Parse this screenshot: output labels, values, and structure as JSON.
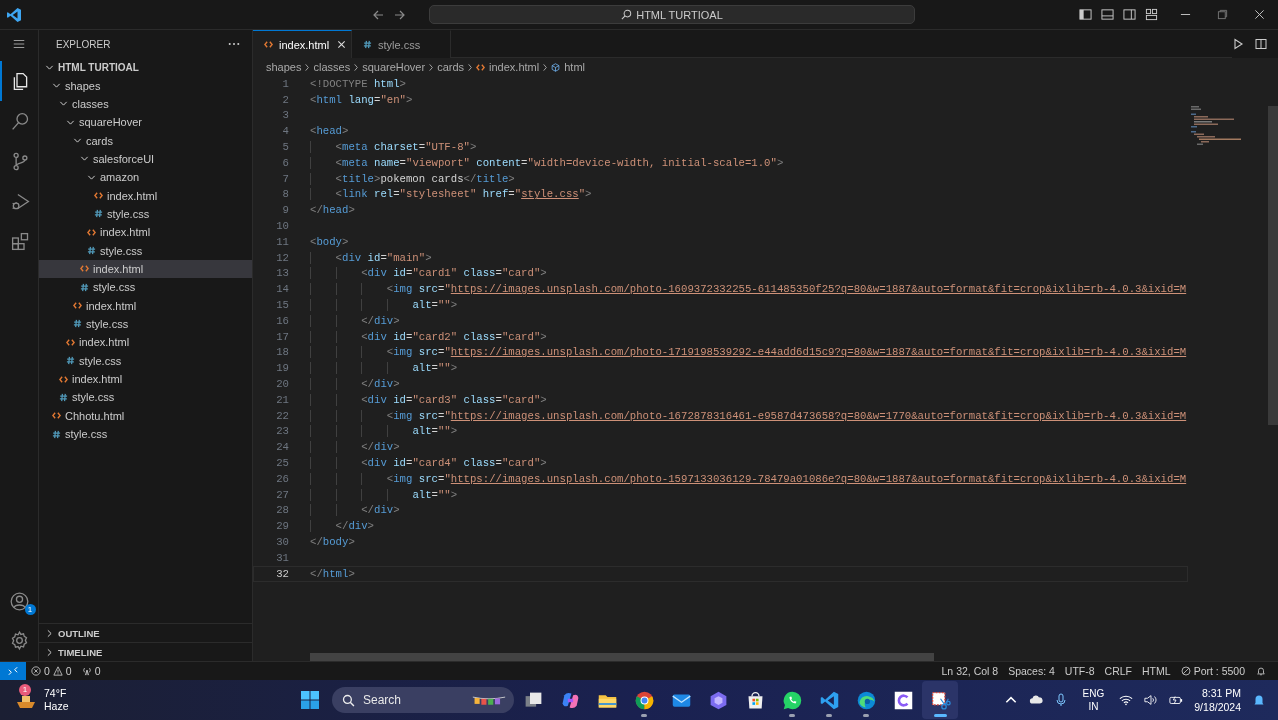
{
  "title_bar": {
    "search": "HTML TURTIOAL"
  },
  "activity_bar": {
    "items": [
      {
        "kind": "explorer",
        "selected": true
      },
      {
        "kind": "search",
        "selected": false
      },
      {
        "kind": "source-control",
        "selected": false
      },
      {
        "kind": "run",
        "selected": false
      },
      {
        "kind": "extensions",
        "selected": false
      }
    ],
    "account_badge": "1"
  },
  "sidebar": {
    "title": "EXPLORER",
    "tree": [
      {
        "label": "HTML TURTIOAL",
        "kind": "root",
        "expanded": true,
        "selected": false,
        "children": [
          {
            "label": "shapes",
            "kind": "folder",
            "expanded": true,
            "selected": false,
            "children": [
              {
                "label": "classes",
                "kind": "folder",
                "expanded": true,
                "selected": false,
                "children": [
                  {
                    "label": "squareHover",
                    "kind": "folder",
                    "expanded": true,
                    "selected": false,
                    "children": [
                      {
                        "label": "cards",
                        "kind": "folder",
                        "expanded": true,
                        "selected": false,
                        "children": [
                          {
                            "label": "salesforceUI",
                            "kind": "folder",
                            "expanded": true,
                            "selected": false,
                            "children": [
                              {
                                "label": "amazon",
                                "kind": "folder",
                                "expanded": true,
                                "selected": false,
                                "children": [
                                  {
                                    "label": "index.html",
                                    "kind": "html",
                                    "selected": false
                                  },
                                  {
                                    "label": "style.css",
                                    "kind": "css",
                                    "selected": false
                                  }
                                ]
                              },
                              {
                                "label": "index.html",
                                "kind": "html",
                                "selected": false
                              },
                              {
                                "label": "style.css",
                                "kind": "css",
                                "selected": false
                              }
                            ]
                          },
                          {
                            "label": "index.html",
                            "kind": "html",
                            "selected": true
                          },
                          {
                            "label": "style.css",
                            "kind": "css",
                            "selected": false
                          }
                        ]
                      },
                      {
                        "label": "index.html",
                        "kind": "html",
                        "selected": false
                      },
                      {
                        "label": "style.css",
                        "kind": "css",
                        "selected": false
                      }
                    ]
                  },
                  {
                    "label": "index.html",
                    "kind": "html",
                    "selected": false
                  },
                  {
                    "label": "style.css",
                    "kind": "css",
                    "selected": false
                  }
                ]
              },
              {
                "label": "index.html",
                "kind": "html",
                "selected": false
              },
              {
                "label": "style.css",
                "kind": "css",
                "selected": false
              }
            ]
          },
          {
            "label": "Chhotu.html",
            "kind": "html",
            "selected": false
          },
          {
            "label": "style.css",
            "kind": "css",
            "selected": false
          }
        ]
      }
    ],
    "sections": [
      {
        "label": "OUTLINE",
        "expanded": false
      },
      {
        "label": "TIMELINE",
        "expanded": false
      }
    ]
  },
  "tabs": [
    {
      "label": "index.html",
      "kind": "html",
      "selected": true
    },
    {
      "label": "style.css",
      "kind": "css",
      "selected": false
    }
  ],
  "breadcrumb": [
    {
      "label": "shapes",
      "kind": "folder"
    },
    {
      "label": "classes",
      "kind": "folder"
    },
    {
      "label": "squareHover",
      "kind": "folder"
    },
    {
      "label": "cards",
      "kind": "folder"
    },
    {
      "label": "index.html",
      "kind": "html"
    },
    {
      "label": "html",
      "kind": "symbol"
    }
  ],
  "editor": {
    "lines": [
      {
        "number": "1",
        "current": false,
        "tokens": [
          {
            "kind": "p",
            "text": "<!DOCTYPE"
          },
          {
            "kind": "a",
            "text": " html"
          },
          {
            "kind": "p",
            "text": ">"
          }
        ]
      },
      {
        "number": "2",
        "current": false,
        "tokens": [
          {
            "kind": "p",
            "text": "<"
          },
          {
            "kind": "t",
            "text": "html"
          },
          {
            "kind": "a",
            "text": " lang"
          },
          {
            "kind": "x",
            "text": "="
          },
          {
            "kind": "s",
            "text": "\"en\""
          },
          {
            "kind": "p",
            "text": ">"
          }
        ]
      },
      {
        "number": "3",
        "current": false
      },
      {
        "number": "4",
        "current": false,
        "tokens": [
          {
            "kind": "p",
            "text": "<"
          },
          {
            "kind": "t",
            "text": "head"
          },
          {
            "kind": "p",
            "text": ">"
          }
        ]
      },
      {
        "number": "5",
        "current": false,
        "tokens": [
          {
            "kind": "p",
            "text": "    <"
          },
          {
            "kind": "t",
            "text": "meta"
          },
          {
            "kind": "a",
            "text": " charset"
          },
          {
            "kind": "x",
            "text": "="
          },
          {
            "kind": "s",
            "text": "\"UTF-8\""
          },
          {
            "kind": "p",
            "text": ">"
          }
        ]
      },
      {
        "number": "6",
        "current": false,
        "tokens": [
          {
            "kind": "p",
            "text": "    <"
          },
          {
            "kind": "t",
            "text": "meta"
          },
          {
            "kind": "a",
            "text": " name"
          },
          {
            "kind": "x",
            "text": "="
          },
          {
            "kind": "s",
            "text": "\"viewport\""
          },
          {
            "kind": "a",
            "text": " content"
          },
          {
            "kind": "x",
            "text": "="
          },
          {
            "kind": "s",
            "text": "\"width=device-width, initial-scale=1.0\""
          },
          {
            "kind": "p",
            "text": ">"
          }
        ]
      },
      {
        "number": "7",
        "current": false,
        "tokens": [
          {
            "kind": "p",
            "text": "    <"
          },
          {
            "kind": "t",
            "text": "title"
          },
          {
            "kind": "p",
            "text": ">"
          },
          {
            "kind": "x",
            "text": "pokemon cards"
          },
          {
            "kind": "p",
            "text": "</"
          },
          {
            "kind": "t",
            "text": "title"
          },
          {
            "kind": "p",
            "text": ">"
          }
        ]
      },
      {
        "number": "8",
        "current": false,
        "tokens": [
          {
            "kind": "p",
            "text": "    <"
          },
          {
            "kind": "t",
            "text": "link"
          },
          {
            "kind": "a",
            "text": " rel"
          },
          {
            "kind": "x",
            "text": "="
          },
          {
            "kind": "s",
            "text": "\"stylesheet\""
          },
          {
            "kind": "a",
            "text": " href"
          },
          {
            "kind": "x",
            "text": "="
          },
          {
            "kind": "s",
            "text": "\""
          },
          {
            "kind": "u",
            "text": "style.css"
          },
          {
            "kind": "s",
            "text": "\""
          },
          {
            "kind": "p",
            "text": ">"
          }
        ]
      },
      {
        "number": "9",
        "current": false,
        "tokens": [
          {
            "kind": "p",
            "text": "</"
          },
          {
            "kind": "t",
            "text": "head"
          },
          {
            "kind": "p",
            "text": ">"
          }
        ]
      },
      {
        "number": "10",
        "current": false
      },
      {
        "number": "11",
        "current": false,
        "tokens": [
          {
            "kind": "p",
            "text": "<"
          },
          {
            "kind": "t",
            "text": "body"
          },
          {
            "kind": "p",
            "text": ">"
          }
        ]
      },
      {
        "number": "12",
        "current": false,
        "tokens": [
          {
            "kind": "p",
            "text": "    <"
          },
          {
            "kind": "t",
            "text": "div"
          },
          {
            "kind": "a",
            "text": " id"
          },
          {
            "kind": "x",
            "text": "="
          },
          {
            "kind": "s",
            "text": "\"main\""
          },
          {
            "kind": "p",
            "text": ">"
          }
        ]
      },
      {
        "number": "13",
        "current": false,
        "tokens": [
          {
            "kind": "p",
            "text": "        <"
          },
          {
            "kind": "t",
            "text": "div"
          },
          {
            "kind": "a",
            "text": " id"
          },
          {
            "kind": "x",
            "text": "="
          },
          {
            "kind": "s",
            "text": "\"card1\""
          },
          {
            "kind": "a",
            "text": " class"
          },
          {
            "kind": "x",
            "text": "="
          },
          {
            "kind": "s",
            "text": "\"card\""
          },
          {
            "kind": "p",
            "text": ">"
          }
        ]
      },
      {
        "number": "14",
        "current": false,
        "tokens": [
          {
            "kind": "p",
            "text": "            <"
          },
          {
            "kind": "t",
            "text": "img"
          },
          {
            "kind": "a",
            "text": " src"
          },
          {
            "kind": "x",
            "text": "="
          },
          {
            "kind": "s",
            "text": "\""
          },
          {
            "kind": "u",
            "text": "https://images.unsplash.com/photo-1609372332255-611485350f25?q=80&w=1887&auto=format&fit=crop&ixlib=rb-4.0.3&ixid=M"
          }
        ]
      },
      {
        "number": "15",
        "current": false,
        "tokens": [
          {
            "kind": "a",
            "text": "                alt"
          },
          {
            "kind": "x",
            "text": "="
          },
          {
            "kind": "s",
            "text": "\"\""
          },
          {
            "kind": "p",
            "text": ">"
          }
        ]
      },
      {
        "number": "16",
        "current": false,
        "tokens": [
          {
            "kind": "p",
            "text": "        </"
          },
          {
            "kind": "t",
            "text": "div"
          },
          {
            "kind": "p",
            "text": ">"
          }
        ]
      },
      {
        "number": "17",
        "current": false,
        "tokens": [
          {
            "kind": "p",
            "text": "        <"
          },
          {
            "kind": "t",
            "text": "div"
          },
          {
            "kind": "a",
            "text": " id"
          },
          {
            "kind": "x",
            "text": "="
          },
          {
            "kind": "s",
            "text": "\"card2\""
          },
          {
            "kind": "a",
            "text": " class"
          },
          {
            "kind": "x",
            "text": "="
          },
          {
            "kind": "s",
            "text": "\"card\""
          },
          {
            "kind": "p",
            "text": ">"
          }
        ]
      },
      {
        "number": "18",
        "current": false,
        "tokens": [
          {
            "kind": "p",
            "text": "            <"
          },
          {
            "kind": "t",
            "text": "img"
          },
          {
            "kind": "a",
            "text": " src"
          },
          {
            "kind": "x",
            "text": "="
          },
          {
            "kind": "s",
            "text": "\""
          },
          {
            "kind": "u",
            "text": "https://images.unsplash.com/photo-1719198539292-e44add6d15c9?q=80&w=1887&auto=format&fit=crop&ixlib=rb-4.0.3&ixid=M"
          }
        ]
      },
      {
        "number": "19",
        "current": false,
        "tokens": [
          {
            "kind": "a",
            "text": "                alt"
          },
          {
            "kind": "x",
            "text": "="
          },
          {
            "kind": "s",
            "text": "\"\""
          },
          {
            "kind": "p",
            "text": ">"
          }
        ]
      },
      {
        "number": "20",
        "current": false,
        "tokens": [
          {
            "kind": "p",
            "text": "        </"
          },
          {
            "kind": "t",
            "text": "div"
          },
          {
            "kind": "p",
            "text": ">"
          }
        ]
      },
      {
        "number": "21",
        "current": false,
        "tokens": [
          {
            "kind": "p",
            "text": "        <"
          },
          {
            "kind": "t",
            "text": "div"
          },
          {
            "kind": "a",
            "text": " id"
          },
          {
            "kind": "x",
            "text": "="
          },
          {
            "kind": "s",
            "text": "\"card3\""
          },
          {
            "kind": "a",
            "text": " class"
          },
          {
            "kind": "x",
            "text": "="
          },
          {
            "kind": "s",
            "text": "\"card\""
          },
          {
            "kind": "p",
            "text": ">"
          }
        ]
      },
      {
        "number": "22",
        "current": false,
        "tokens": [
          {
            "kind": "p",
            "text": "            <"
          },
          {
            "kind": "t",
            "text": "img"
          },
          {
            "kind": "a",
            "text": " src"
          },
          {
            "kind": "x",
            "text": "="
          },
          {
            "kind": "s",
            "text": "\""
          },
          {
            "kind": "u",
            "text": "https://images.unsplash.com/photo-1672878316461-e9587d473658?q=80&w=1770&auto=format&fit=crop&ixlib=rb-4.0.3&ixid=M"
          }
        ]
      },
      {
        "number": "23",
        "current": false,
        "tokens": [
          {
            "kind": "a",
            "text": "                alt"
          },
          {
            "kind": "x",
            "text": "="
          },
          {
            "kind": "s",
            "text": "\"\""
          },
          {
            "kind": "p",
            "text": ">"
          }
        ]
      },
      {
        "number": "24",
        "current": false,
        "tokens": [
          {
            "kind": "p",
            "text": "        </"
          },
          {
            "kind": "t",
            "text": "div"
          },
          {
            "kind": "p",
            "text": ">"
          }
        ]
      },
      {
        "number": "25",
        "current": false,
        "tokens": [
          {
            "kind": "p",
            "text": "        <"
          },
          {
            "kind": "t",
            "text": "div"
          },
          {
            "kind": "a",
            "text": " id"
          },
          {
            "kind": "x",
            "text": "="
          },
          {
            "kind": "s",
            "text": "\"card4\""
          },
          {
            "kind": "a",
            "text": " class"
          },
          {
            "kind": "x",
            "text": "="
          },
          {
            "kind": "s",
            "text": "\"card\""
          },
          {
            "kind": "p",
            "text": ">"
          }
        ]
      },
      {
        "number": "26",
        "current": false,
        "tokens": [
          {
            "kind": "p",
            "text": "            <"
          },
          {
            "kind": "t",
            "text": "img"
          },
          {
            "kind": "a",
            "text": " src"
          },
          {
            "kind": "x",
            "text": "="
          },
          {
            "kind": "s",
            "text": "\""
          },
          {
            "kind": "u",
            "text": "https://images.unsplash.com/photo-1597133036129-78479a01086e?q=80&w=1887&auto=format&fit=crop&ixlib=rb-4.0.3&ixid=M"
          }
        ]
      },
      {
        "number": "27",
        "current": false,
        "tokens": [
          {
            "kind": "a",
            "text": "                alt"
          },
          {
            "kind": "x",
            "text": "="
          },
          {
            "kind": "s",
            "text": "\"\""
          },
          {
            "kind": "p",
            "text": ">"
          }
        ]
      },
      {
        "number": "28",
        "current": false,
        "tokens": [
          {
            "kind": "p",
            "text": "        </"
          },
          {
            "kind": "t",
            "text": "div"
          },
          {
            "kind": "p",
            "text": ">"
          }
        ]
      },
      {
        "number": "29",
        "current": false,
        "tokens": [
          {
            "kind": "p",
            "text": "    </"
          },
          {
            "kind": "t",
            "text": "div"
          },
          {
            "kind": "p",
            "text": ">"
          }
        ]
      },
      {
        "number": "30",
        "current": false,
        "tokens": [
          {
            "kind": "p",
            "text": "</"
          },
          {
            "kind": "t",
            "text": "body"
          },
          {
            "kind": "p",
            "text": ">"
          }
        ]
      },
      {
        "number": "31",
        "current": false
      },
      {
        "number": "32",
        "current": true,
        "tokens": [
          {
            "kind": "p",
            "text": "</"
          },
          {
            "kind": "t",
            "text": "html"
          },
          {
            "kind": "p",
            "text": ">"
          }
        ]
      }
    ]
  },
  "status_bar": {
    "errors": "0",
    "warnings": "0",
    "ports": "0",
    "right": [
      {
        "kind": "text",
        "text": "Ln 32, Col 8"
      },
      {
        "kind": "text",
        "text": "Spaces: 4"
      },
      {
        "kind": "text",
        "text": "UTF-8"
      },
      {
        "kind": "text",
        "text": "CRLF"
      },
      {
        "kind": "text",
        "text": "HTML"
      },
      {
        "kind": "port",
        "text": "Port : 5500"
      }
    ]
  },
  "taskbar": {
    "weather": {
      "temperature": "74°F",
      "condition": "Haze",
      "badge": "1"
    },
    "search": "Search",
    "apps": [
      {
        "kind": "task-view",
        "running": false,
        "selected": false
      },
      {
        "kind": "copilot",
        "running": false,
        "selected": false
      },
      {
        "kind": "files",
        "running": false,
        "selected": false
      },
      {
        "kind": "chrome",
        "running": true,
        "selected": false
      },
      {
        "kind": "mail",
        "running": false,
        "selected": false
      },
      {
        "kind": "hexagon",
        "running": false,
        "selected": false
      },
      {
        "kind": "store",
        "running": false,
        "selected": false
      },
      {
        "kind": "whatsapp",
        "running": true,
        "selected": false
      },
      {
        "kind": "vscode",
        "running": true,
        "selected": false
      },
      {
        "kind": "edge",
        "running": true,
        "selected": false
      },
      {
        "kind": "canva",
        "running": false,
        "selected": false
      },
      {
        "kind": "snip",
        "running": true,
        "selected": true
      }
    ],
    "language": [
      "ENG",
      "IN"
    ],
    "time": "8:31 PM",
    "date": "9/18/2024"
  }
}
